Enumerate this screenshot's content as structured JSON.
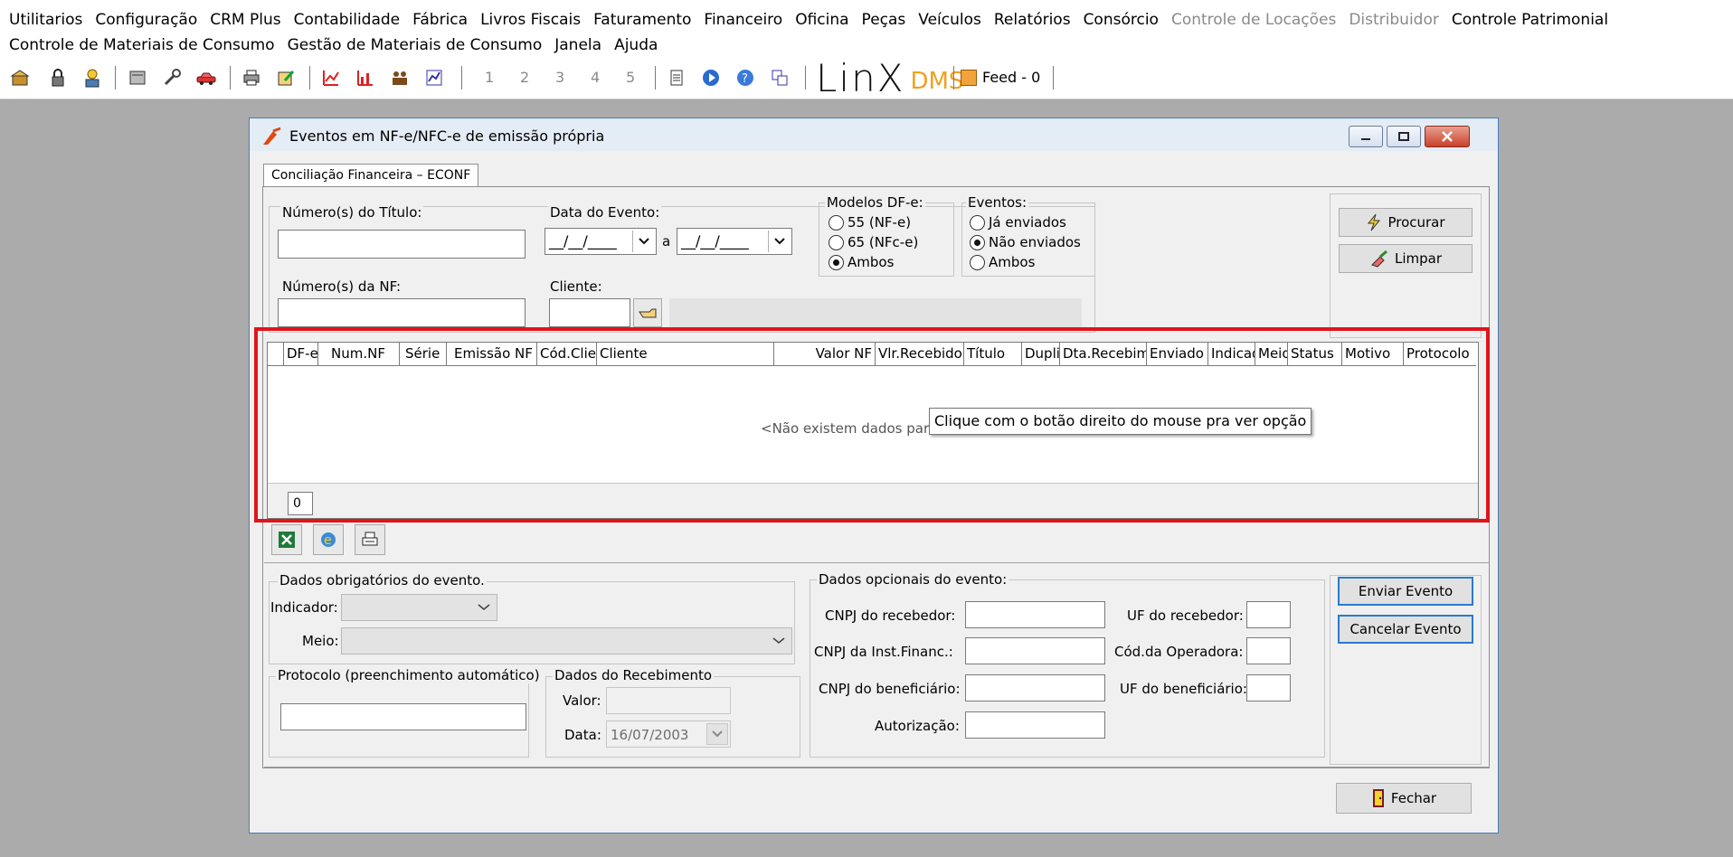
{
  "menubar": {
    "row1": [
      {
        "label": "Utilitarios",
        "enabled": true
      },
      {
        "label": "Configuração",
        "enabled": true
      },
      {
        "label": "CRM Plus",
        "enabled": true
      },
      {
        "label": "Contabilidade",
        "enabled": true
      },
      {
        "label": "Fábrica",
        "enabled": true
      },
      {
        "label": "Livros Fiscais",
        "enabled": true
      },
      {
        "label": "Faturamento",
        "enabled": true
      },
      {
        "label": "Financeiro",
        "enabled": true
      },
      {
        "label": "Oficina",
        "enabled": true
      },
      {
        "label": "Peças",
        "enabled": true
      },
      {
        "label": "Veículos",
        "enabled": true
      },
      {
        "label": "Relatórios",
        "enabled": true
      },
      {
        "label": "Consórcio",
        "enabled": true
      },
      {
        "label": "Controle de Locações",
        "enabled": false
      },
      {
        "label": "Distribuidor",
        "enabled": false
      },
      {
        "label": "Controle Patrimonial",
        "enabled": true
      }
    ],
    "row2": [
      {
        "label": "Controle de Materiais de Consumo",
        "enabled": true
      },
      {
        "label": "Gestão de Materiais de Consumo",
        "enabled": true
      },
      {
        "label": "Janela",
        "enabled": true
      },
      {
        "label": "Ajuda",
        "enabled": true
      }
    ]
  },
  "toolbar": {
    "pages": [
      "1",
      "2",
      "3",
      "4",
      "5"
    ],
    "logo_text": "LinX",
    "logo_suffix": "DMS",
    "feed_label": "Feed - 0"
  },
  "window": {
    "title": "Eventos em NF-e/NFC-e de emissão própria",
    "tab_label": "Conciliação Financeira – ECONF"
  },
  "filters": {
    "titulo_label": "Número(s) do Título:",
    "data_evento_label": "Data do Evento:",
    "date_from": "__/__/____",
    "date_to": "__/__/____",
    "date_sep": "a",
    "nf_label": "Número(s) da NF:",
    "cliente_label": "Cliente:",
    "modelos_label": "Modelos DF-e:",
    "modelos": [
      {
        "label": "55 (NF-e)",
        "checked": false
      },
      {
        "label": "65 (NFc-e)",
        "checked": false
      },
      {
        "label": "Ambos",
        "checked": true
      }
    ],
    "eventos_label": "Eventos:",
    "eventos": [
      {
        "label": "Já enviados",
        "checked": false
      },
      {
        "label": "Não enviados",
        "checked": true
      },
      {
        "label": "Ambos",
        "checked": false
      }
    ],
    "procurar_label": "Procurar",
    "limpar_label": "Limpar"
  },
  "grid": {
    "columns": [
      "DF-e",
      "Num.NF",
      "Série",
      "Emissão NF",
      "Cód.Cliente",
      "Cliente",
      "Valor NF",
      "Vlr.Recebido",
      "Título",
      "Duplic",
      "Dta.Recebim",
      "Enviado",
      "Indicador",
      "Meio",
      "Status",
      "Motivo",
      "Protocolo"
    ],
    "empty_message": "<Não existem dados para",
    "record_count": "0",
    "tooltip": "Clique com o botão direito do mouse pra ver opção"
  },
  "evento": {
    "obrigatorios_label": "Dados obrigatórios do evento.",
    "indicador_label": "Indicador:",
    "meio_label": "Meio:",
    "protocolo_label": "Protocolo (preenchimento automático)",
    "recebimento_label": "Dados do Recebimento",
    "valor_label": "Valor:",
    "data_label": "Data:",
    "data_value": "16/07/2003",
    "opcionais_label": "Dados opcionais do evento:",
    "cnpj_recebedor_label": "CNPJ do recebedor:",
    "cnpj_inst_label": "CNPJ da Inst.Financ.:",
    "cnpj_benef_label": "CNPJ do beneficiário:",
    "autorizacao_label": "Autorização:",
    "uf_recebedor_label": "UF do recebedor:",
    "cod_operadora_label": "Cód.da Operadora:",
    "uf_benef_label": "UF do beneficiário:",
    "enviar_label": "Enviar Evento",
    "cancelar_label": "Cancelar Evento",
    "fechar_label": "Fechar"
  },
  "colors": {
    "highlight_border": "#e0141a",
    "focus_border": "#2a7ad0",
    "logo_accent": "#f0a020"
  }
}
